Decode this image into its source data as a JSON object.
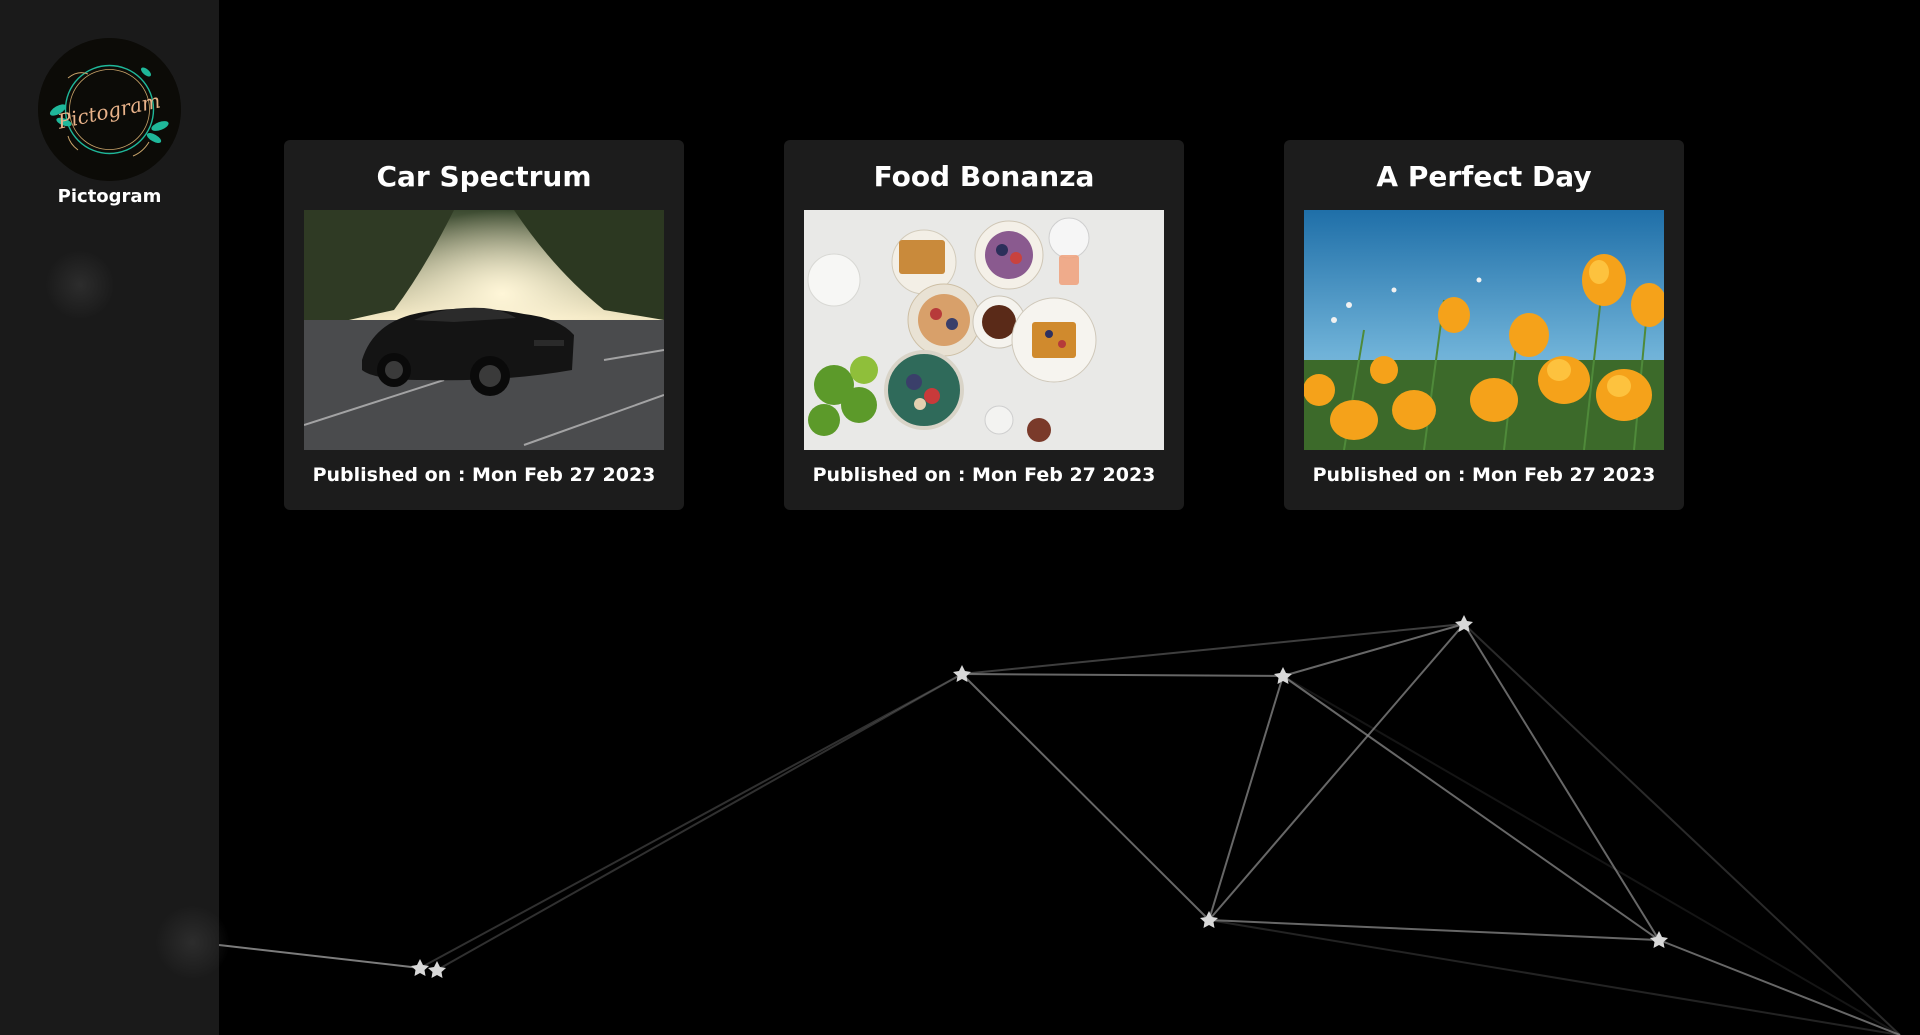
{
  "sidebar": {
    "logo_icon": "pictogram-logo-icon",
    "logo_script": "Pictogram",
    "brand_label": "Pictogram"
  },
  "colors": {
    "background": "#000000",
    "sidebar": "#1a1a1a",
    "card": "#1c1c1c",
    "text": "#ffffff",
    "logo_accent": "#1fb89a"
  },
  "posts": [
    {
      "title": "Car Spectrum",
      "image": "black-sports-car-photo",
      "published": "Published on : Mon Feb 27 2023"
    },
    {
      "title": "Food Bonanza",
      "image": "breakfast-table-photo",
      "published": "Published on : Mon Feb 27 2023"
    },
    {
      "title": "A Perfect Day",
      "image": "orange-flowers-photo",
      "published": "Published on : Mon Feb 27 2023"
    }
  ]
}
